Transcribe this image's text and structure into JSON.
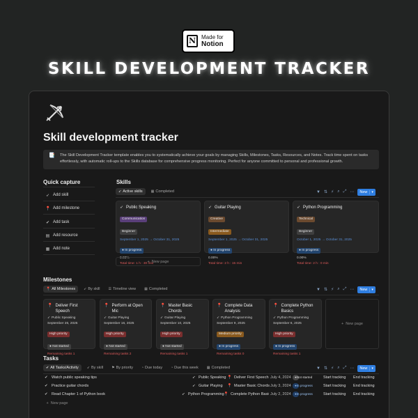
{
  "badge": {
    "line1": "Made for",
    "line2": "Notion",
    "logo_letter": "N"
  },
  "hero_title": "SKILL DEVELOPMENT TRACKER",
  "page": {
    "icon": "bow-and-arrow-icon",
    "title": "Skill development tracker",
    "callout_icon": "📑",
    "callout_text": "The Skill Development Tracker template enables you to systematically achieve your goals by managing Skills, Milestones, Tasks, Resources, and Notes. Track time spent on tasks effortlessly, with automatic roll-ups to the Skills database for comprehensive progress monitoring. Perfect for anyone committed to personal and professional growth."
  },
  "quick_capture": {
    "heading": "Quick capture",
    "items": [
      {
        "label": "Add skill",
        "icon": "bow-icon"
      },
      {
        "label": "Add milestone",
        "icon": "pin-icon"
      },
      {
        "label": "Add task",
        "icon": "check-circle-icon"
      },
      {
        "label": "Add resource",
        "icon": "book-icon"
      },
      {
        "label": "Add note",
        "icon": "note-icon"
      }
    ]
  },
  "skills": {
    "heading": "Skills",
    "tabs": [
      "Active skills",
      "Completed"
    ],
    "new_label": "New",
    "new_page": "New page",
    "cards": [
      {
        "title": "Public Speaking",
        "category": "Communication",
        "level": "Beginner",
        "dates": "September 1, 2025 → October 31, 2025",
        "status": "In progress",
        "percent": "0.00%",
        "time": "Total time: 1 h : 30 min"
      },
      {
        "title": "Guitar Playing",
        "category": "Creative",
        "level": "Intermediate",
        "dates": "September 1, 2025 → October 31, 2025",
        "status": "In progress",
        "percent": "0.00%",
        "time": "Total time: 2 h : 15 min"
      },
      {
        "title": "Python Programming",
        "category": "Technical",
        "level": "Beginner",
        "dates": "October 1, 2025 → October 31, 2025",
        "status": "In progress",
        "percent": "0.00%",
        "time": "Total time: 2 h : 0 min"
      }
    ]
  },
  "milestones": {
    "heading": "Milestones",
    "tabs": [
      "All Milestones",
      "By skill",
      "Timeline view",
      "Completed"
    ],
    "new_label": "New",
    "new_page": "New page",
    "cards": [
      {
        "title": "Deliver First Speech",
        "skill": "Public Speaking",
        "date": "September 26, 2025",
        "priority": "High priority",
        "status": "Not started",
        "remaining": "Remaining tasks 1"
      },
      {
        "title": "Perform at Open Mic",
        "skill": "Guitar Playing",
        "date": "September 16, 2025",
        "priority": "High priority",
        "status": "Not started",
        "remaining": "Remaining tasks 2"
      },
      {
        "title": "Master Basic Chords",
        "skill": "Guitar Playing",
        "date": "September 10, 2025",
        "priority": "High priority",
        "status": "Not started",
        "remaining": "Remaining tasks 1"
      },
      {
        "title": "Complete Data Analysis",
        "skill": "Python Programming",
        "date": "September 9, 2025",
        "priority": "Medium priority",
        "status": "In progress",
        "remaining": "Remaining tasks 0"
      },
      {
        "title": "Complete Python Basics",
        "skill": "Python Programming",
        "date": "September 6, 2025",
        "priority": "High priority",
        "status": "In progress",
        "remaining": "Remaining tasks 1"
      }
    ]
  },
  "tasks": {
    "heading": "Tasks",
    "tabs": [
      "All Tasks/Activity",
      "By skill",
      "By priority",
      "Due today",
      "Due this week",
      "Completed"
    ],
    "new_label": "New",
    "new_page": "New page",
    "rows": [
      {
        "name": "Watch public speaking tips",
        "skill": "Public Speaking",
        "milestone": "Deliver First Speech",
        "date": "July 4, 2024",
        "status": "Not started",
        "start": "Start tracking",
        "end": "End tracking"
      },
      {
        "name": "Practice guitar chords",
        "skill": "Guitar Playing",
        "milestone": "Master Basic Chords",
        "date": "July 3, 2024",
        "status": "In progress",
        "start": "Start tracking",
        "end": "End tracking"
      },
      {
        "name": "Read Chapter 1 of Python book",
        "skill": "Python Programming",
        "milestone": "Complete Python Basics",
        "date": "July 2, 2024",
        "status": "In progress",
        "start": "Start tracking",
        "end": "End tracking"
      }
    ]
  },
  "colors": {
    "accent": "#2f7ee0",
    "background": "#222423",
    "window": "#191919",
    "card": "#262626",
    "danger": "#e05b5b",
    "link": "#5a8fd6"
  }
}
